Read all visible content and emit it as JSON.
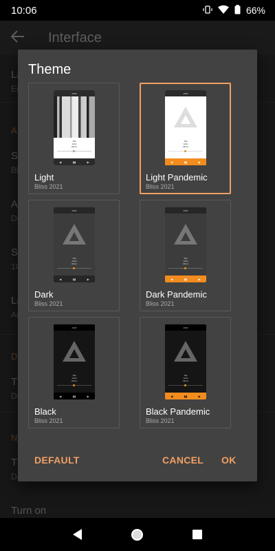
{
  "status": {
    "time": "10:06",
    "battery": "66%"
  },
  "background": {
    "title": "Interface",
    "rows": [
      "La",
      "Er",
      "A",
      "Si",
      "Bl",
      "A",
      "Di",
      "Si",
      "1C",
      "La",
      "Au",
      "D",
      "Th",
      "Do",
      "N",
      "Th",
      "Dark mode",
      "Turn on"
    ]
  },
  "dialog": {
    "title": "Theme",
    "themes": [
      {
        "name": "Light",
        "author": "Bliss 2021"
      },
      {
        "name": "Light Pandemic",
        "author": "Bliss 2021"
      },
      {
        "name": "Dark",
        "author": "Bliss 2021"
      },
      {
        "name": "Dark Pandemic",
        "author": "Bliss 2021"
      },
      {
        "name": "Black",
        "author": "Bliss 2021"
      },
      {
        "name": "Black Pandemic",
        "author": "Bliss 2021"
      }
    ],
    "selected": "Light Pandemic",
    "preview": {
      "app": "AIMP",
      "track": "Title",
      "artist": "Artist",
      "album": "Album"
    },
    "buttons": {
      "default": "DEFAULT",
      "cancel": "CANCEL",
      "ok": "OK"
    }
  },
  "colors": {
    "accent": "#f2a063",
    "pandemic_orange": "#f28c1e",
    "dialog_bg": "#424242"
  }
}
